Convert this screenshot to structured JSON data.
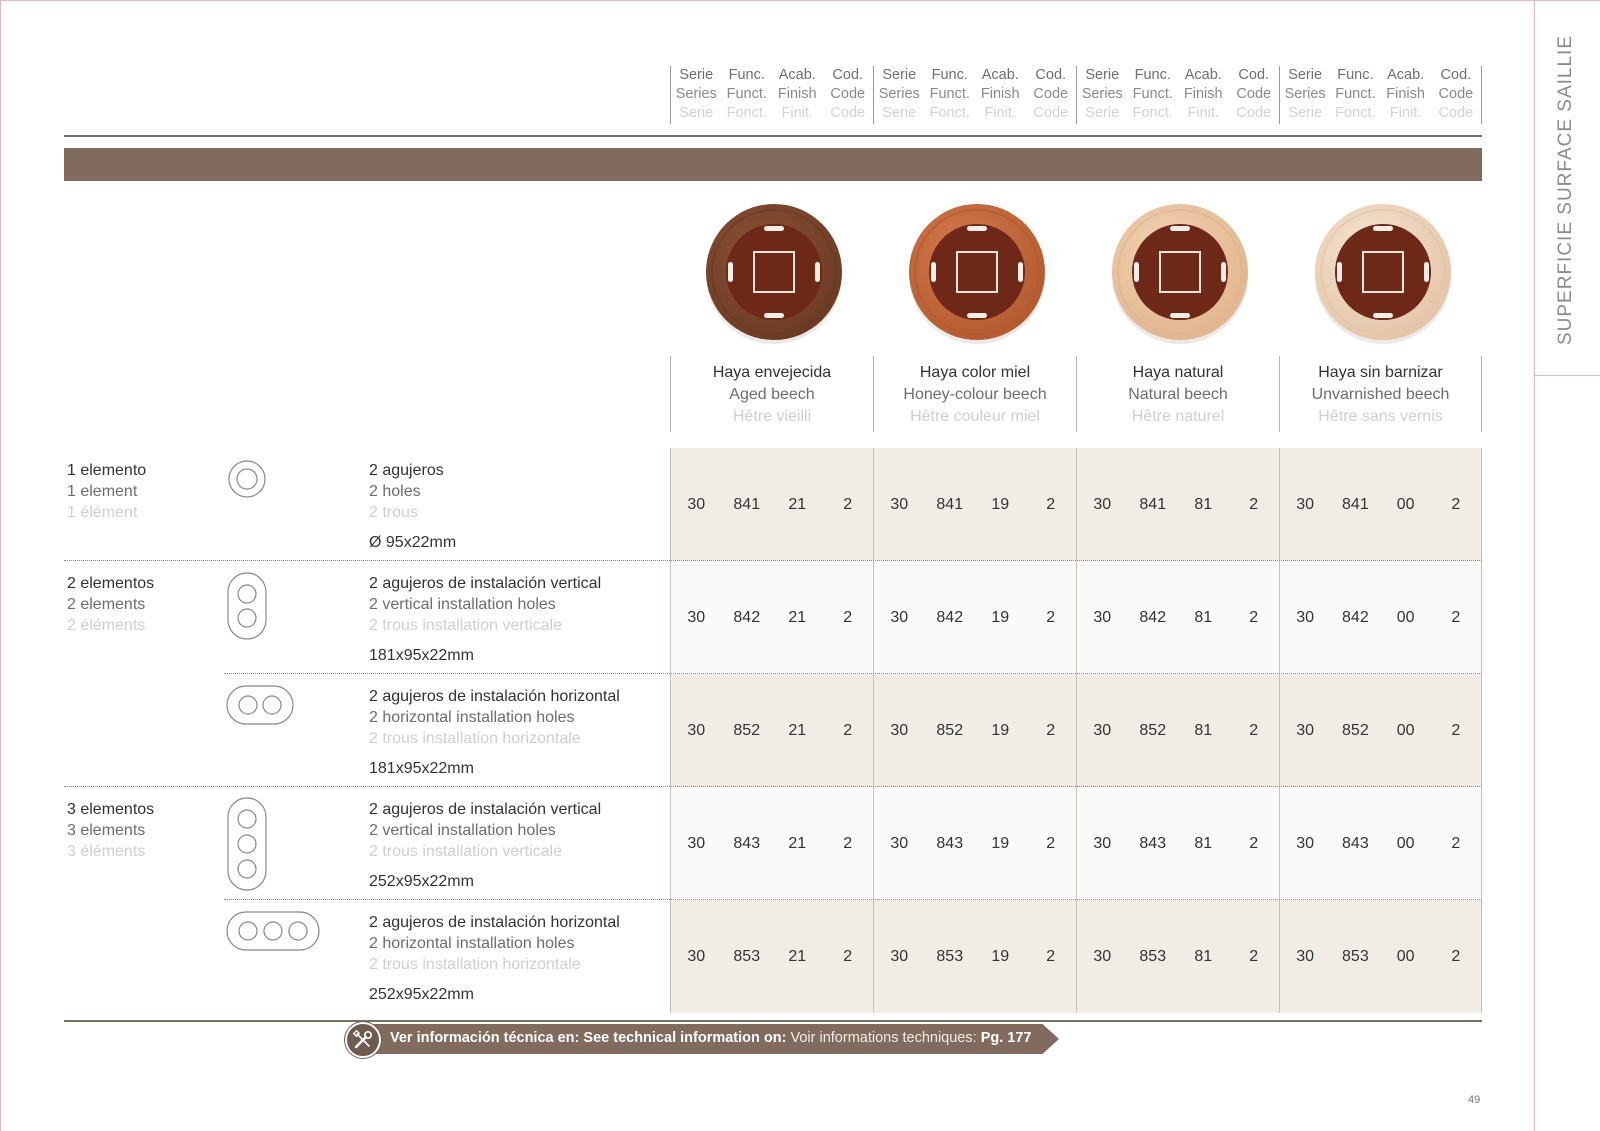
{
  "side_title": "SUPERFICIE SURFACE SAILLIE",
  "column_groups": [
    {
      "cols": [
        [
          "Serie",
          "Series",
          "Serie"
        ],
        [
          "Func.",
          "Funct.",
          "Fonct."
        ],
        [
          "Acab.",
          "Finish",
          "Finit."
        ],
        [
          "Cod.",
          "Code",
          "Code"
        ]
      ]
    },
    {
      "cols": [
        [
          "Serie",
          "Series",
          "Serie"
        ],
        [
          "Func.",
          "Funct.",
          "Fonct."
        ],
        [
          "Acab.",
          "Finish",
          "Finit."
        ],
        [
          "Cod.",
          "Code",
          "Code"
        ]
      ]
    },
    {
      "cols": [
        [
          "Serie",
          "Series",
          "Serie"
        ],
        [
          "Func.",
          "Funct.",
          "Fonct."
        ],
        [
          "Acab.",
          "Finish",
          "Finit."
        ],
        [
          "Cod.",
          "Code",
          "Code"
        ]
      ]
    },
    {
      "cols": [
        [
          "Serie",
          "Series",
          "Serie"
        ],
        [
          "Func.",
          "Funct.",
          "Fonct."
        ],
        [
          "Acab.",
          "Finish",
          "Finit."
        ],
        [
          "Cod.",
          "Code",
          "Code"
        ]
      ]
    }
  ],
  "finishes": [
    {
      "es": "Haya envejecida",
      "en": "Aged beech",
      "fr": "Hêtre vieilli",
      "ring": "#6b3a24",
      "ring_light": "#8a5134"
    },
    {
      "es": "Haya color miel",
      "en": "Honey-colour beech",
      "fr": "Hêtre couleur miel",
      "ring": "#b2592f",
      "ring_light": "#d37c4d"
    },
    {
      "es": "Haya natural",
      "en": "Natural beech",
      "fr": "Hêtre naturel",
      "ring": "#e0b48d",
      "ring_light": "#f2d3b4"
    },
    {
      "es": "Haya sin barnizar",
      "en": "Unvarnished beech",
      "fr": "Hêtre sans vernis",
      "ring": "#e3c4a6",
      "ring_light": "#f6e4d2"
    }
  ],
  "rows": [
    {
      "elements": {
        "es": "1 elemento",
        "en": "1 element",
        "fr": "1 élément"
      },
      "icon": "single-round-frame-icon",
      "desc": {
        "es": "2 agujeros",
        "en": "2 holes",
        "fr": "2 trous",
        "dim": "Ø 95x22mm"
      },
      "codes": [
        [
          "30",
          "841",
          "21",
          "2"
        ],
        [
          "30",
          "841",
          "19",
          "2"
        ],
        [
          "30",
          "841",
          "81",
          "2"
        ],
        [
          "30",
          "841",
          "00",
          "2"
        ]
      ]
    },
    {
      "elements": {
        "es": "2 elementos",
        "en": "2 elements",
        "fr": "2 éléments"
      },
      "icon": "double-vertical-frame-icon",
      "desc": {
        "es": "2 agujeros de instalación vertical",
        "en": "2 vertical installation holes",
        "fr": "2 trous installation verticale",
        "dim": "181x95x22mm"
      },
      "codes": [
        [
          "30",
          "842",
          "21",
          "2"
        ],
        [
          "30",
          "842",
          "19",
          "2"
        ],
        [
          "30",
          "842",
          "81",
          "2"
        ],
        [
          "30",
          "842",
          "00",
          "2"
        ]
      ]
    },
    {
      "elements": {
        "es": "",
        "en": "",
        "fr": ""
      },
      "icon": "double-horizontal-frame-icon",
      "desc": {
        "es": "2 agujeros de instalación horizontal",
        "en": "2 horizontal installation holes",
        "fr": "2 trous installation horizontale",
        "dim": "181x95x22mm"
      },
      "codes": [
        [
          "30",
          "852",
          "21",
          "2"
        ],
        [
          "30",
          "852",
          "19",
          "2"
        ],
        [
          "30",
          "852",
          "81",
          "2"
        ],
        [
          "30",
          "852",
          "00",
          "2"
        ]
      ]
    },
    {
      "elements": {
        "es": "3 elementos",
        "en": "3 elements",
        "fr": "3 éléments"
      },
      "icon": "triple-vertical-frame-icon",
      "desc": {
        "es": "2 agujeros de instalación vertical",
        "en": "2 vertical installation holes",
        "fr": "2 trous installation verticale",
        "dim": "252x95x22mm"
      },
      "codes": [
        [
          "30",
          "843",
          "21",
          "2"
        ],
        [
          "30",
          "843",
          "19",
          "2"
        ],
        [
          "30",
          "843",
          "81",
          "2"
        ],
        [
          "30",
          "843",
          "00",
          "2"
        ]
      ]
    },
    {
      "elements": {
        "es": "",
        "en": "",
        "fr": ""
      },
      "icon": "triple-horizontal-frame-icon",
      "desc": {
        "es": "2 agujeros de instalación horizontal",
        "en": "2 horizontal installation holes",
        "fr": "2 trous installation horizontale",
        "dim": "252x95x22mm"
      },
      "codes": [
        [
          "30",
          "853",
          "21",
          "2"
        ],
        [
          "30",
          "853",
          "19",
          "2"
        ],
        [
          "30",
          "853",
          "81",
          "2"
        ],
        [
          "30",
          "853",
          "00",
          "2"
        ]
      ]
    }
  ],
  "tech_info": {
    "es": "Ver información técnica en:",
    "en": "See technical information on:",
    "fr": "Voir informations techniques:",
    "page": "Pg. 177",
    "icon": "tools-icon"
  },
  "page_number": "49",
  "colors": {
    "brown": "#806b5e",
    "rule": "#7a6e66",
    "cell_a": "#f1ece6",
    "cell_b": "#fbfaf8",
    "accent_pink": "#e3b6c4"
  }
}
